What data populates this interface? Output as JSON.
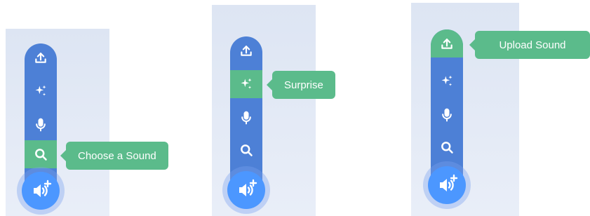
{
  "colors": {
    "panel_bg": "#dde5f3",
    "menu_blue": "#4d80d6",
    "active_green": "#5bbb8b",
    "main_button": "#4c97ff"
  },
  "icons": [
    "upload-icon",
    "sparkle-icon",
    "microphone-icon",
    "search-icon",
    "speaker-add-icon"
  ],
  "menus": [
    {
      "active_item": "search",
      "tooltip": "Choose a Sound"
    },
    {
      "active_item": "surprise",
      "tooltip": "Surprise"
    },
    {
      "active_item": "upload",
      "tooltip": "Upload Sound"
    }
  ]
}
